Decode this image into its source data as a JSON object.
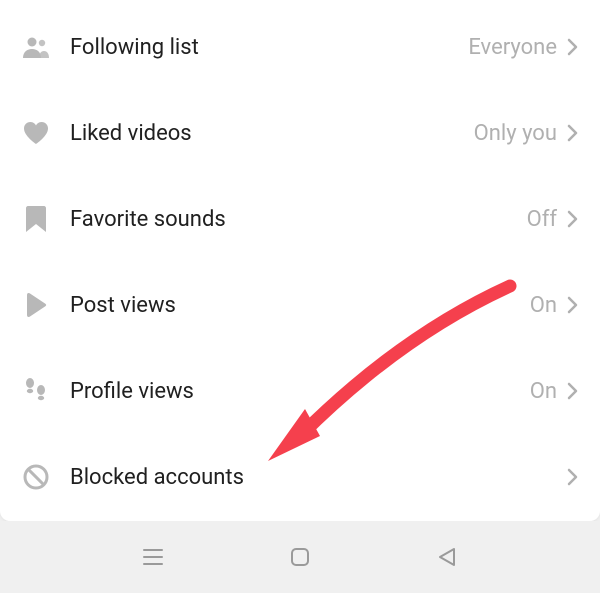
{
  "settings": {
    "items": [
      {
        "label": "Following list",
        "value": "Everyone",
        "icon": "group"
      },
      {
        "label": "Liked videos",
        "value": "Only you",
        "icon": "heart"
      },
      {
        "label": "Favorite sounds",
        "value": "Off",
        "icon": "bookmark"
      },
      {
        "label": "Post views",
        "value": "On",
        "icon": "play"
      },
      {
        "label": "Profile views",
        "value": "On",
        "icon": "footsteps"
      },
      {
        "label": "Blocked accounts",
        "value": "",
        "icon": "ban"
      }
    ]
  },
  "annotation": {
    "color": "#f5404d",
    "target": "blocked-accounts"
  }
}
